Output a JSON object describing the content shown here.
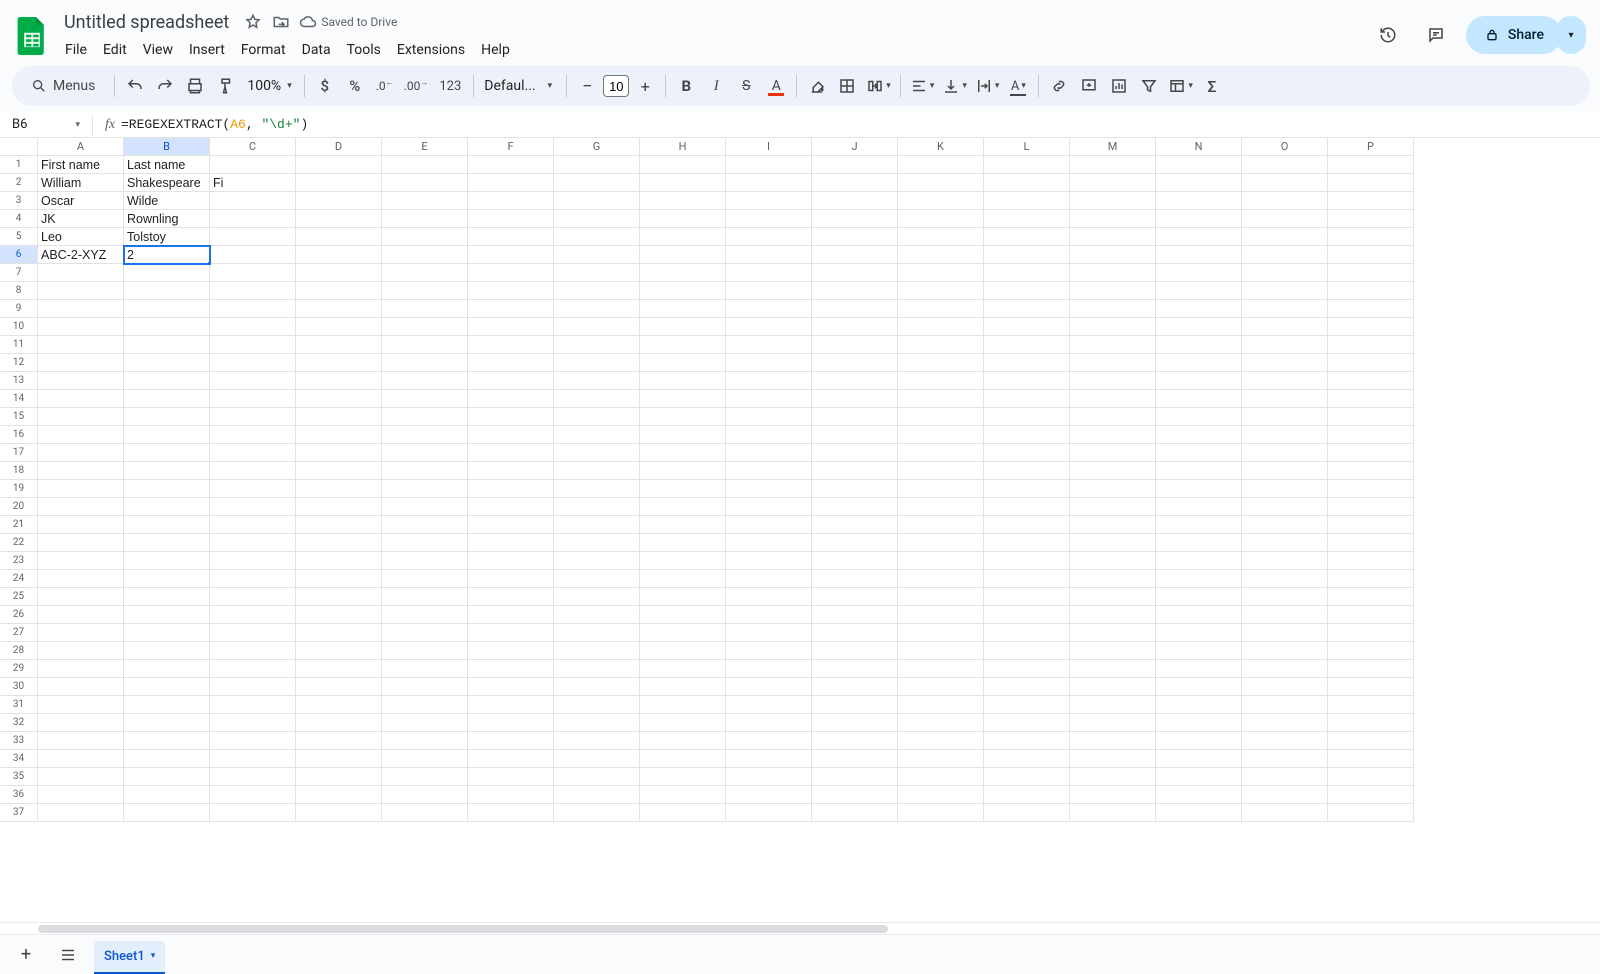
{
  "doc": {
    "title": "Untitled spreadsheet",
    "saved": "Saved to Drive"
  },
  "menu": {
    "file": "File",
    "edit": "Edit",
    "view": "View",
    "insert": "Insert",
    "format": "Format",
    "data": "Data",
    "tools": "Tools",
    "extensions": "Extensions",
    "help": "Help"
  },
  "toolbar": {
    "menus": "Menus",
    "zoom": "100%",
    "font": "Defaul...",
    "fontsize": "10",
    "format123": "123"
  },
  "share": {
    "label": "Share"
  },
  "namebox": "B6",
  "formula": {
    "prefix": "=REGEXEXTRACT(",
    "ref": "A6",
    "comma": ", ",
    "str": "\"\\d+\"",
    "suffix": ")"
  },
  "columns": [
    "A",
    "B",
    "C",
    "D",
    "E",
    "F",
    "G",
    "H",
    "I",
    "J",
    "K",
    "L",
    "M",
    "N",
    "O",
    "P"
  ],
  "rowcount": 37,
  "active": {
    "row": 6,
    "col": "B"
  },
  "cells": {
    "A1": "First name",
    "B1": "Last name",
    "A2": "William",
    "B2": "Shakespeare",
    "C2": "Fi",
    "A3": "Oscar",
    "B3": "Wilde",
    "A4": "JK",
    "B4": "Rownling",
    "A5": "Leo",
    "B5": "Tolstoy",
    "A6": "ABC-2-XYZ",
    "B6": "2"
  },
  "sheet_tab": "Sheet1"
}
